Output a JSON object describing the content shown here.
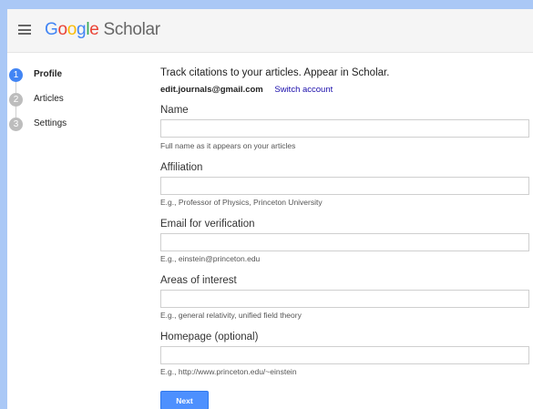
{
  "header": {
    "logo_text": "Google",
    "logo_suffix": "Scholar"
  },
  "steps": [
    {
      "number": "1",
      "label": "Profile",
      "active": true
    },
    {
      "number": "2",
      "label": "Articles",
      "active": false
    },
    {
      "number": "3",
      "label": "Settings",
      "active": false
    }
  ],
  "form": {
    "intro": "Track citations to your articles. Appear in Scholar.",
    "account_email": "edit.journals@gmail.com",
    "switch_account": "Switch account",
    "fields": [
      {
        "label": "Name",
        "value": "",
        "hint": "Full name as it appears on your articles"
      },
      {
        "label": "Affiliation",
        "value": "",
        "hint": "E.g., Professor of Physics, Princeton University"
      },
      {
        "label": "Email for verification",
        "value": "",
        "hint": "E.g., einstein@princeton.edu"
      },
      {
        "label": "Areas of interest",
        "value": "",
        "hint": "E.g., general relativity, unified field theory"
      },
      {
        "label": "Homepage (optional)",
        "value": "",
        "hint": "E.g., http://www.princeton.edu/~einstein"
      }
    ],
    "next_label": "Next"
  },
  "colors": {
    "accent": "#4285f4",
    "button": "#4d90fe",
    "link": "#1a0dab",
    "page_background": "#aac8f6"
  }
}
